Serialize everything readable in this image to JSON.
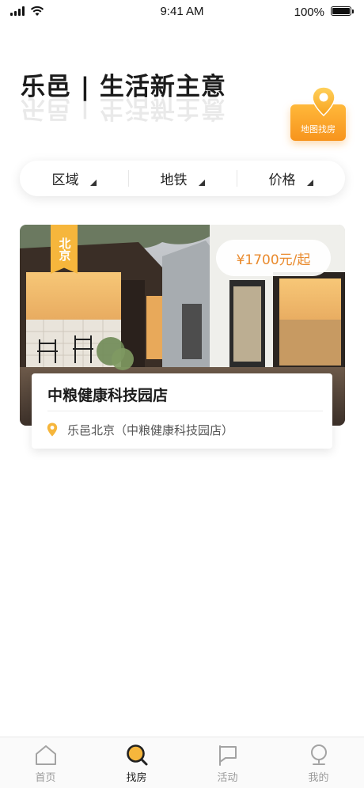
{
  "status_bar": {
    "time": "9:41 AM",
    "battery": "100%"
  },
  "header": {
    "headline": "乐邑 | 生活新主意",
    "map_button_label": "地图找房"
  },
  "filters": [
    {
      "label": "区域"
    },
    {
      "label": "地铁"
    },
    {
      "label": "价格"
    }
  ],
  "listing": {
    "city": "北京",
    "price": "¥1700元/起",
    "name": "中粮健康科技园店",
    "address": "乐邑北京（中粮健康科技园店）"
  },
  "tabs": [
    {
      "label": "首页",
      "icon": "home-icon",
      "active": false
    },
    {
      "label": "找房",
      "icon": "search-house-icon",
      "active": true
    },
    {
      "label": "活动",
      "icon": "flag-icon",
      "active": false
    },
    {
      "label": "我的",
      "icon": "profile-icon",
      "active": false
    }
  ],
  "colors": {
    "accent": "#f6b63c",
    "price": "#e98a2d",
    "map_button": "#f7941d"
  }
}
